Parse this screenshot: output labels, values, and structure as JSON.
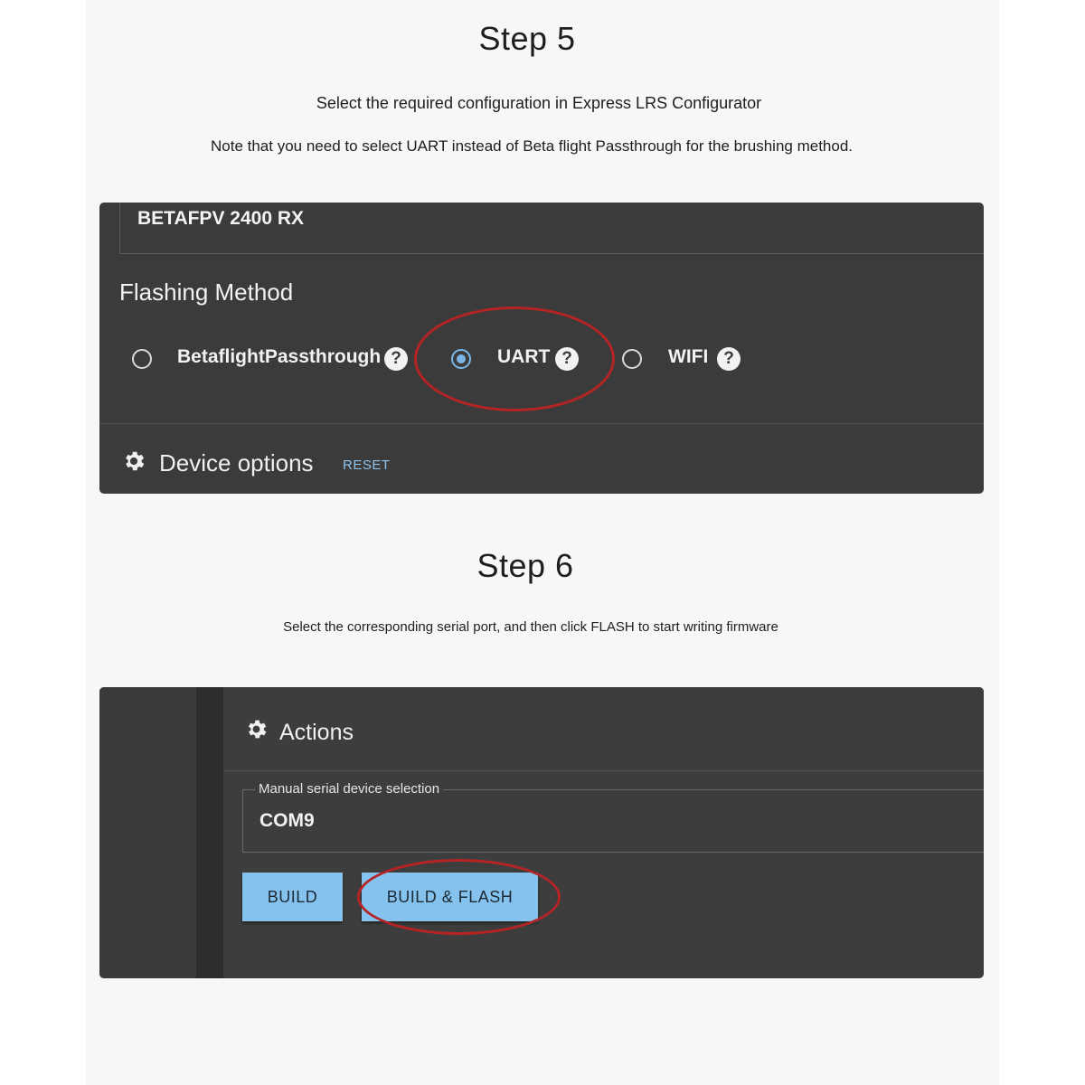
{
  "step5": {
    "title": "Step 5",
    "line1": "Select the required configuration in Express LRS Configurator",
    "line2": "Note that you need to select UART instead of Beta flight Passthrough for the brushing method."
  },
  "panel5": {
    "device_target": "BETAFPV 2400 RX",
    "flashing_method_title": "Flashing Method",
    "options": [
      {
        "label": "BetaflightPassthrough",
        "selected": false
      },
      {
        "label": "UART",
        "selected": true
      },
      {
        "label": "WIFI",
        "selected": false
      }
    ],
    "help_glyph": "?",
    "device_options_title": "Device options",
    "reset_label": "RESET",
    "highlight_color": "#b52424"
  },
  "step6": {
    "title": "Step 6",
    "line1": "Select the corresponding serial port, and then click FLASH to start writing firmware"
  },
  "panel6": {
    "actions_title": "Actions",
    "serial_label": "Manual serial device selection",
    "serial_value": "COM9",
    "build_label": "BUILD",
    "build_flash_label": "BUILD & FLASH",
    "button_color": "#85c2ee",
    "highlight_color": "#b52424"
  }
}
